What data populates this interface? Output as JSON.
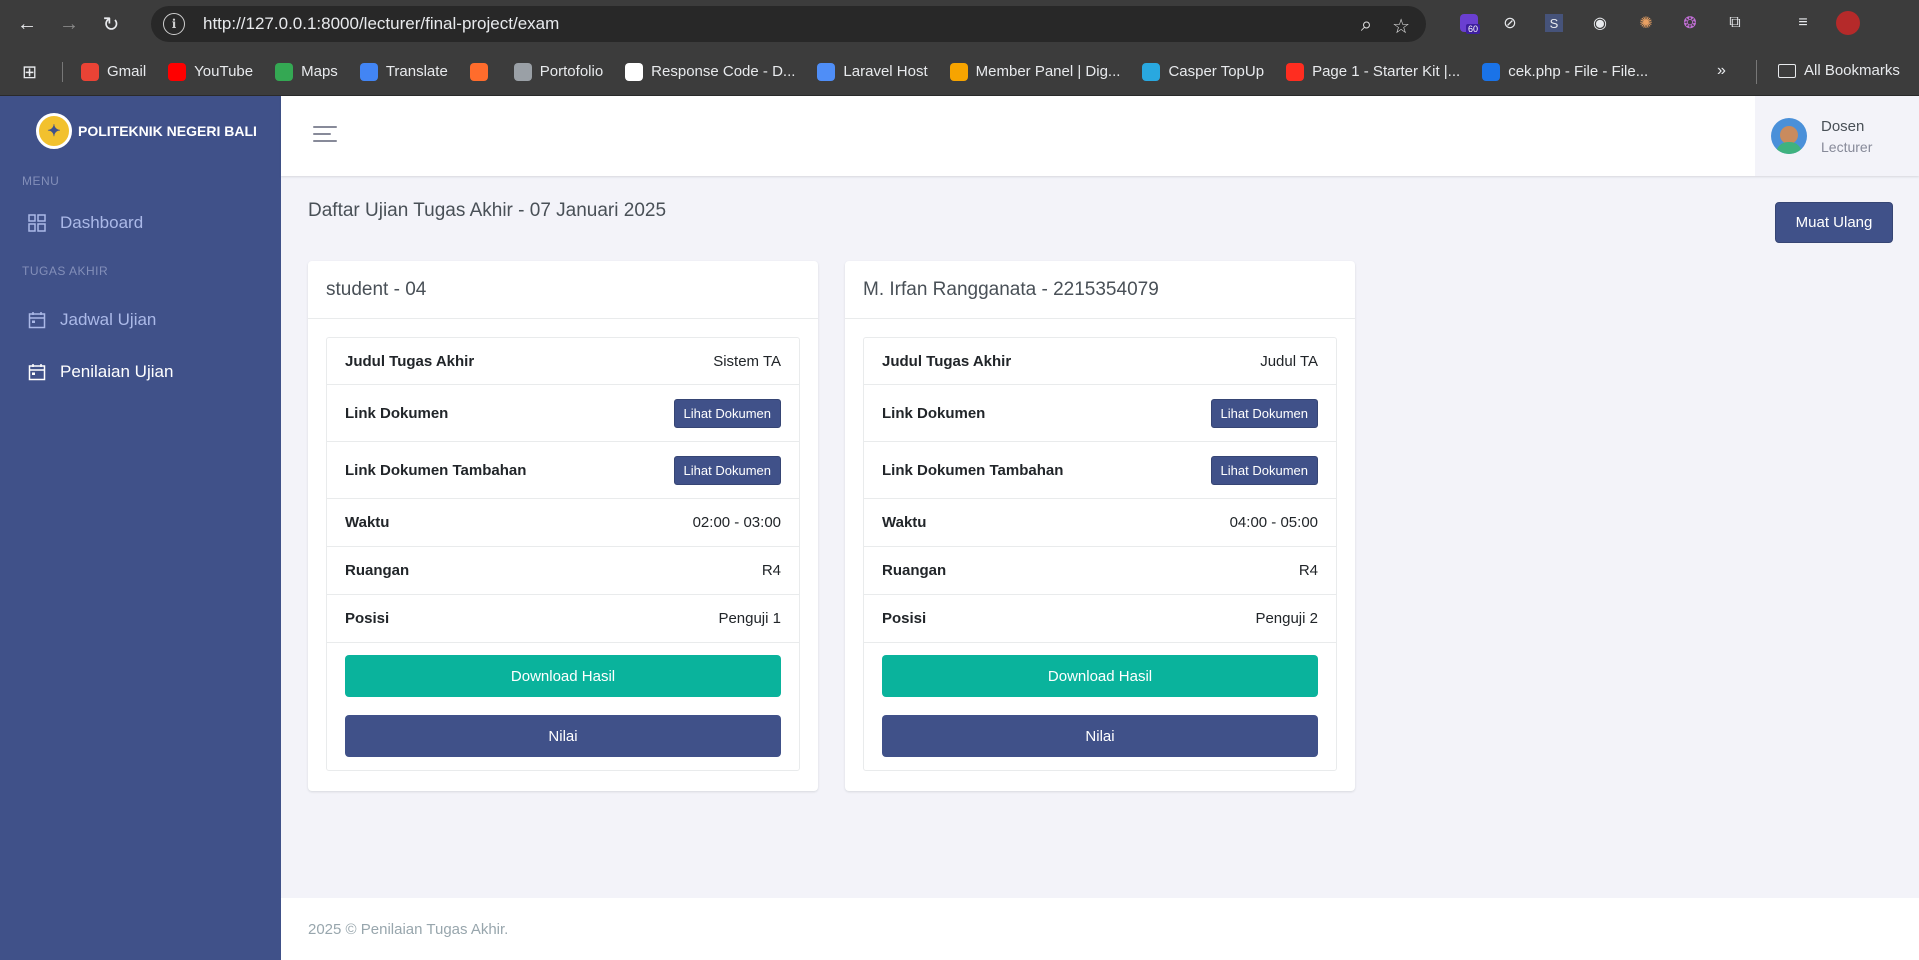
{
  "browser": {
    "url": "http://127.0.0.1:8000/lecturer/final-project/exam",
    "extension_badge": "60",
    "bookmarks": [
      {
        "label": "Gmail",
        "icon": "gmail-icon",
        "color": "#ea4335"
      },
      {
        "label": "YouTube",
        "icon": "youtube-icon",
        "color": "#ff0000"
      },
      {
        "label": "Maps",
        "icon": "maps-icon",
        "color": "#34a853"
      },
      {
        "label": "Translate",
        "icon": "translate-icon",
        "color": "#4285f4"
      },
      {
        "label": "",
        "icon": "cpanel-icon",
        "color": "#ff6c2c"
      },
      {
        "label": "Portofolio",
        "icon": "globe-icon",
        "color": "#9aa0a6"
      },
      {
        "label": "Response Code - D...",
        "icon": "code-icon",
        "color": "#ffffff"
      },
      {
        "label": "Laravel Host",
        "icon": "laravel-host-icon",
        "color": "#4f8ef7"
      },
      {
        "label": "Member Panel | Dig...",
        "icon": "digital-icon",
        "color": "#f7a400"
      },
      {
        "label": "Casper TopUp",
        "icon": "casper-icon",
        "color": "#29a8e0"
      },
      {
        "label": "Page 1 - Starter Kit |...",
        "icon": "laravel-icon",
        "color": "#ff2d20"
      },
      {
        "label": "cek.php - File - File...",
        "icon": "file-icon",
        "color": "#1a73e8"
      }
    ],
    "all_bookmarks": "All Bookmarks"
  },
  "sidebar": {
    "brand": "POLITEKNIK NEGERI BALI",
    "menu_title": "MENU",
    "dashboard": "Dashboard",
    "section_title": "TUGAS AKHIR",
    "jadwal": "Jadwal Ujian",
    "penilaian": "Penilaian Ujian"
  },
  "user": {
    "name": "Dosen",
    "role": "Lecturer"
  },
  "page": {
    "title": "Daftar Ujian Tugas Akhir - 07 Januari 2025",
    "reload": "Muat Ulang"
  },
  "labels": {
    "judul": "Judul Tugas Akhir",
    "link": "Link Dokumen",
    "link_tambahan": "Link Dokumen Tambahan",
    "waktu": "Waktu",
    "ruangan": "Ruangan",
    "posisi": "Posisi",
    "lihat": "Lihat Dokumen",
    "download": "Download Hasil",
    "nilai": "Nilai"
  },
  "cards": [
    {
      "header": "student - 04",
      "judul": "Sistem TA",
      "waktu": "02:00 - 03:00",
      "ruangan": "R4",
      "posisi": "Penguji 1"
    },
    {
      "header": "M. Irfan Rangganata - 2215354079",
      "judul": "Judul TA",
      "waktu": "04:00 - 05:00",
      "ruangan": "R4",
      "posisi": "Penguji 2"
    }
  ],
  "footer": "2025 © Penilaian Tugas Akhir."
}
